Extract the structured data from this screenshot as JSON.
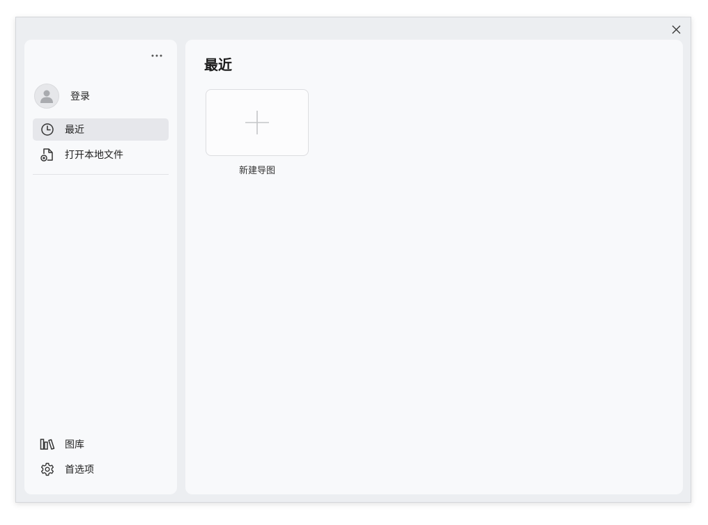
{
  "window": {
    "close_icon": "close-icon"
  },
  "sidebar": {
    "more_icon": "more-horizontal-icon",
    "user": {
      "avatar_icon": "user-avatar-icon",
      "label": "登录"
    },
    "nav_items": [
      {
        "label": "最近",
        "icon": "clock-icon",
        "active": true
      },
      {
        "label": "打开本地文件",
        "icon": "open-file-icon",
        "active": false
      }
    ],
    "bottom_items": [
      {
        "label": "图库",
        "icon": "library-icon"
      },
      {
        "label": "首选项",
        "icon": "gear-icon"
      }
    ]
  },
  "main": {
    "title": "最近",
    "new_card": {
      "icon": "plus-icon",
      "label": "新建导图"
    }
  },
  "colors": {
    "window_bg": "#eceef1",
    "panel_bg": "#f8f9fb",
    "active_item_bg": "#e6e7eb",
    "icon_color": "#333333"
  }
}
